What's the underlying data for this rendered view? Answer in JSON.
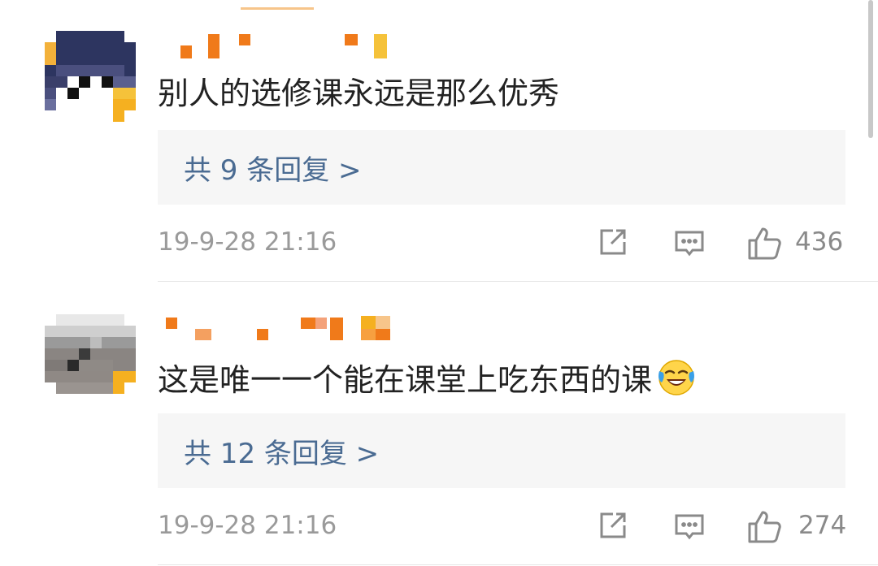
{
  "comments": [
    {
      "username": "",
      "text": "别人的选修课永远是那么优秀",
      "reply_label": "共 9 条回复 >",
      "timestamp": "19-9-28 21:16",
      "likes": "436",
      "emoji": ""
    },
    {
      "username": "",
      "text": "这是唯一一个能在课堂上吃东西的课",
      "reply_label": "共 12 条回复 >",
      "timestamp": "19-9-28 21:16",
      "likes": "274",
      "emoji": "laughing-crying-emoji"
    }
  ],
  "icons": {
    "share": "share-icon",
    "comment": "comment-icon",
    "like": "thumbs-up-icon"
  },
  "colors": {
    "reply_link": "#4a6b92",
    "reply_bg": "#f6f6f6",
    "text": "#222222",
    "meta": "#9a9a9a",
    "pixelate_orange": "#f07a1a",
    "pixelate_yellow": "#f5c23a"
  }
}
